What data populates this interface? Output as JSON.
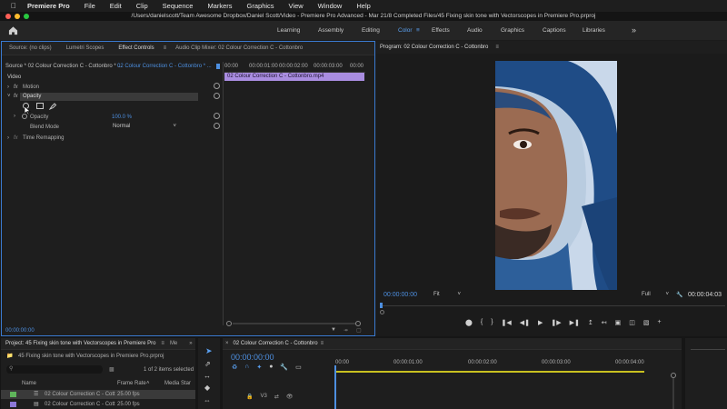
{
  "menubar": {
    "app": "Premiere Pro",
    "items": [
      "File",
      "Edit",
      "Clip",
      "Sequence",
      "Markers",
      "Graphics",
      "View",
      "Window",
      "Help"
    ]
  },
  "path": "/Users/danielscott/Team Awesome Dropbox/Daniel Scott/Video - Premiere Pro Advanced - Mar 21/8 Completed Files/45 Fixing skin tone with Vectorscopes in Premiere Pro.prproj",
  "workspaces": [
    "Learning",
    "Assembly",
    "Editing",
    "Color",
    "Effects",
    "Audio",
    "Graphics",
    "Captions",
    "Libraries"
  ],
  "workspace_more": "»",
  "source_panel": {
    "tabs": [
      "Source: (no clips)",
      "Lumetri Scopes",
      "Effect Controls",
      "Audio Clip Mixer: 02 Colour Correction C - Cottonbro"
    ],
    "active_tab": "Effect Controls",
    "source_label": "Source * 02 Colour Correction C - Cottonbro * ...",
    "sequence_label": "02 Colour Correction C - Cottonbro * ...",
    "ruler": [
      "00:00",
      "00:00:01:00",
      "00:00:02:00",
      "00:00:03:00",
      "00:00"
    ],
    "clip_name": "02 Colour Correction C - Cottonbro.mp4",
    "section_video": "Video",
    "effects": [
      "Motion",
      "Opacity",
      "Time Remapping"
    ],
    "opacity_label": "Opacity",
    "opacity_value": "100.0 %",
    "blend_label": "Blend Mode",
    "blend_value": "Normal",
    "timecode": "00:00:00:00"
  },
  "program": {
    "title": "Program: 02 Colour Correction C - Cottonbro",
    "timecode": "00:00:00:00",
    "fit": "Fit",
    "quality": "Full",
    "duration": "00:00:04:03"
  },
  "project": {
    "tabs": [
      "Project: 45 Fixing skin tone with Vectorscopes in Premiere Pro",
      "Me"
    ],
    "file": "45 Fixing skin tone with Vectorscopes in Premiere Pro.prproj",
    "selected_count": "1 of 2 items selected",
    "columns": [
      "Name",
      "Frame Rate",
      "Media Star"
    ],
    "rows": [
      {
        "name": "02 Colour Correction C - Cott",
        "rate": "25.00 fps"
      },
      {
        "name": "02 Colour Correction C - Cott",
        "rate": "25.00 fps"
      }
    ]
  },
  "timeline": {
    "tab": "02 Colour Correction C - Cottonbro",
    "timecode": "00:00:00:00",
    "ruler": [
      "00:00",
      "00:00:01:00",
      "00:00:02:00",
      "00:00:03:00",
      "00:00:04:00"
    ],
    "track": "V3"
  },
  "colors": {
    "accent": "#3a7ad0",
    "clip_purple": "#a98de0",
    "timecode_blue": "#4d8fe0"
  }
}
